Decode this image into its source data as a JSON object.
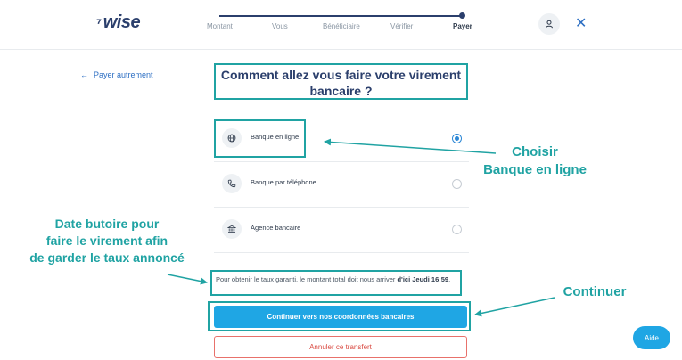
{
  "header": {
    "logo_flag": "⁷",
    "logo_text": "wise",
    "steps": [
      "Montant",
      "Vous",
      "Bénéficiaire",
      "Vérifier",
      "Payer"
    ],
    "close_glyph": "✕"
  },
  "back_link": {
    "arrow": "←",
    "label": "Payer autrement"
  },
  "page_title": "Comment allez vous faire votre virement bancaire ?",
  "options": [
    {
      "label": "Banque en ligne",
      "icon": "globe-icon",
      "selected": true
    },
    {
      "label": "Banque par téléphone",
      "icon": "phone-icon",
      "selected": false
    },
    {
      "label": "Agence bancaire",
      "icon": "bank-icon",
      "selected": false
    }
  ],
  "notice": {
    "text": "Pour obtenir le taux garanti, le montant total doit nous arriver ",
    "deadline": "d'ici Jeudi 16:59",
    "end": "."
  },
  "buttons": {
    "continue": "Continuer vers nos coordonnées bancaires",
    "cancel": "Annuler ce transfert",
    "help": "Aide"
  },
  "annotations": {
    "choose_line1": "Choisir",
    "choose_line2": "Banque en ligne",
    "deadline_line1": "Date butoire pour",
    "deadline_line2": "faire le virement afin",
    "deadline_line3": "de garder le taux annoncé",
    "continue": "Continuer"
  },
  "colors": {
    "accent": "#1fa6e4",
    "annotation": "#20a3a3",
    "brand": "#2b3f6c",
    "danger": "#d94b43"
  }
}
